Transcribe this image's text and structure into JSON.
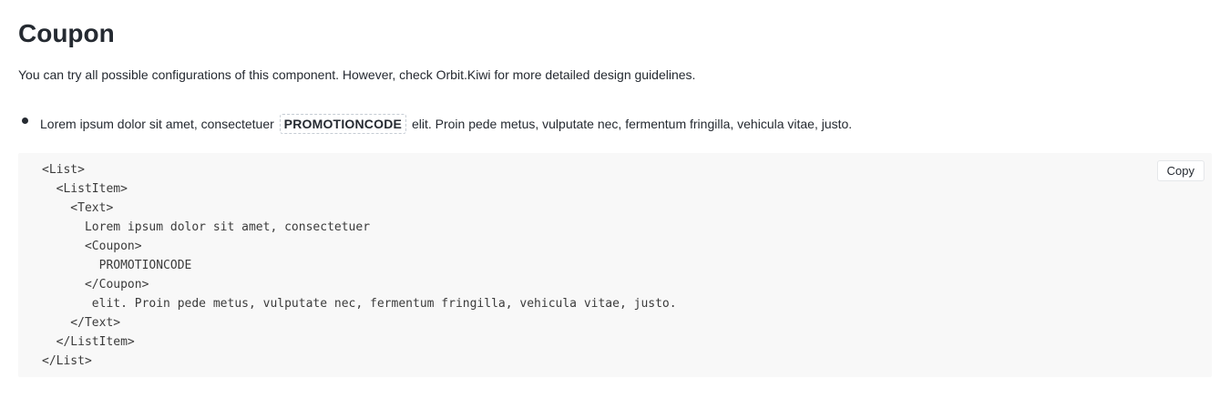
{
  "page": {
    "title": "Coupon",
    "intro": "You can try all possible configurations of this component. However, check Orbit.Kiwi for more detailed design guidelines."
  },
  "preview": {
    "list_item": {
      "text_before": "Lorem ipsum dolor sit amet, consectetuer",
      "coupon": "PROMOTIONCODE",
      "text_after": "elit. Proin pede metus, vulputate nec, fermentum fringilla, vehicula vitae, justo."
    }
  },
  "code_block": {
    "copy_label": "Copy",
    "code": "<List>\n  <ListItem>\n    <Text>\n      Lorem ipsum dolor sit amet, consectetuer\n      <Coupon>\n        PROMOTIONCODE\n      </Coupon>\n       elit. Proin pede metus, vulputate nec, fermentum fringilla, vehicula vitae, justo.\n    </Text>\n  </ListItem>\n</List>"
  }
}
